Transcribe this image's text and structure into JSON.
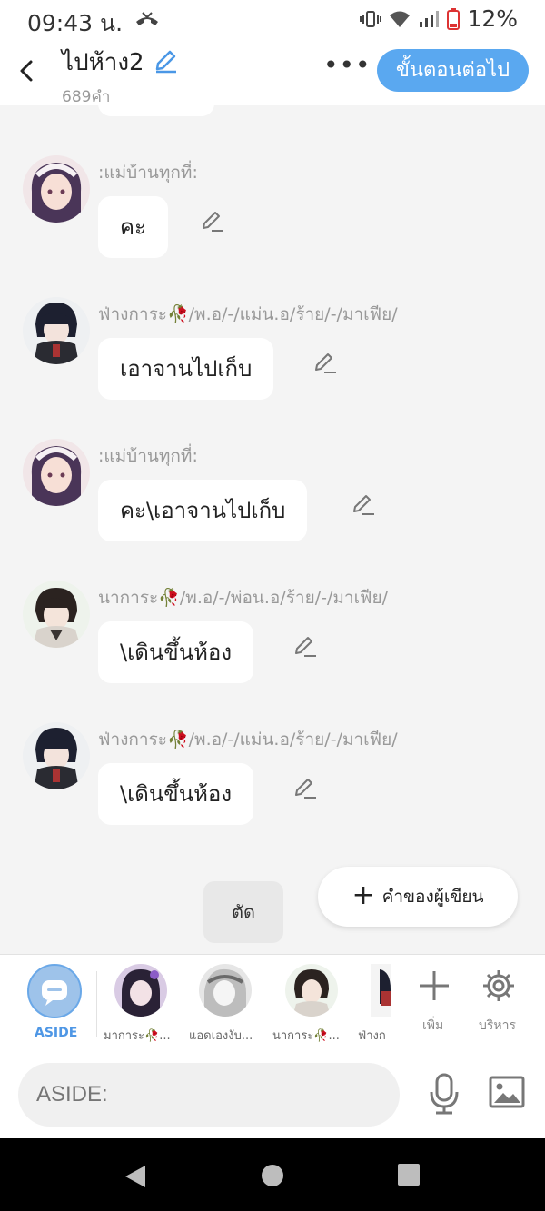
{
  "status": {
    "time": "09:43 น.",
    "battery": "12%"
  },
  "header": {
    "title": "ไปห้าง2",
    "word_count": "689คำ",
    "next_label": "ขั้นตอนต่อไป"
  },
  "messages": [
    {
      "speaker": ":แม่บ้านทุกที่:",
      "text": "คะ"
    },
    {
      "speaker": "ฟ่างการะ🥀/พ.อ/-/แม่น.อ/ร้าย/-/มาเฟีย/",
      "text": "เอาจานไปเก็บ"
    },
    {
      "speaker": ":แม่บ้านทุกที่:",
      "text": "คะ\\เอาจานไปเก็บ"
    },
    {
      "speaker": "นาการะ🥀/พ.อ/-/พ่อน.อ/ร้าย/-/มาเฟีย/",
      "text": "\\เดินขึ้นห้อง"
    },
    {
      "speaker": "ฟ่างการะ🥀/พ.อ/-/แม่น.อ/ร้าย/-/มาเฟีย/",
      "text": "\\เดินขึ้นห้อง"
    }
  ],
  "actions": {
    "cut_label": "ตัด",
    "writer_label": "คำของผู้เขียน"
  },
  "characters": {
    "aside_label": "ASIDE",
    "items": [
      {
        "label": "มาการะ🥀..."
      },
      {
        "label": "แอดเองงับ..."
      },
      {
        "label": "นาการะ🥀..."
      },
      {
        "label": "ฟ่างก"
      }
    ],
    "add_label": "เพิ่ม",
    "manage_label": "บริหาร"
  },
  "input": {
    "placeholder": "ASIDE:"
  },
  "colors": {
    "accent": "#5aa8f0",
    "background": "#f4f4f4"
  }
}
